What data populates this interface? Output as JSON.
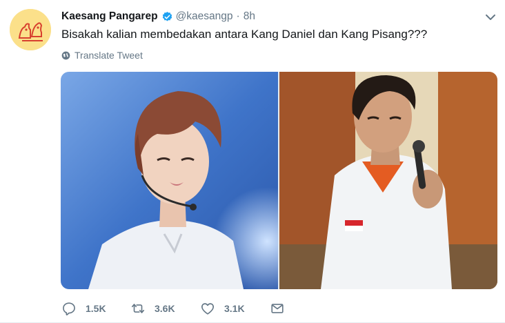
{
  "tweet": {
    "author_name": "Kaesang Pangarep",
    "handle": "@kaesangp",
    "separator": "·",
    "time": "8h",
    "text": "Bisakah kalian membedakan antara Kang Daniel dan Kang Pisang???",
    "translate_label": "Translate Tweet",
    "verified": true
  },
  "actions": {
    "replies": "1.5K",
    "retweets": "3.6K",
    "likes": "3.1K"
  },
  "icons": {
    "avatar": "avatar-illustration",
    "verified": "verified-badge-icon",
    "menu": "chevron-down-icon",
    "translate": "globe-icon",
    "reply": "reply-icon",
    "retweet": "retweet-icon",
    "like": "heart-icon",
    "dm": "envelope-icon"
  },
  "colors": {
    "accent": "#1da1f2",
    "muted": "#657786",
    "text": "#14171a"
  }
}
